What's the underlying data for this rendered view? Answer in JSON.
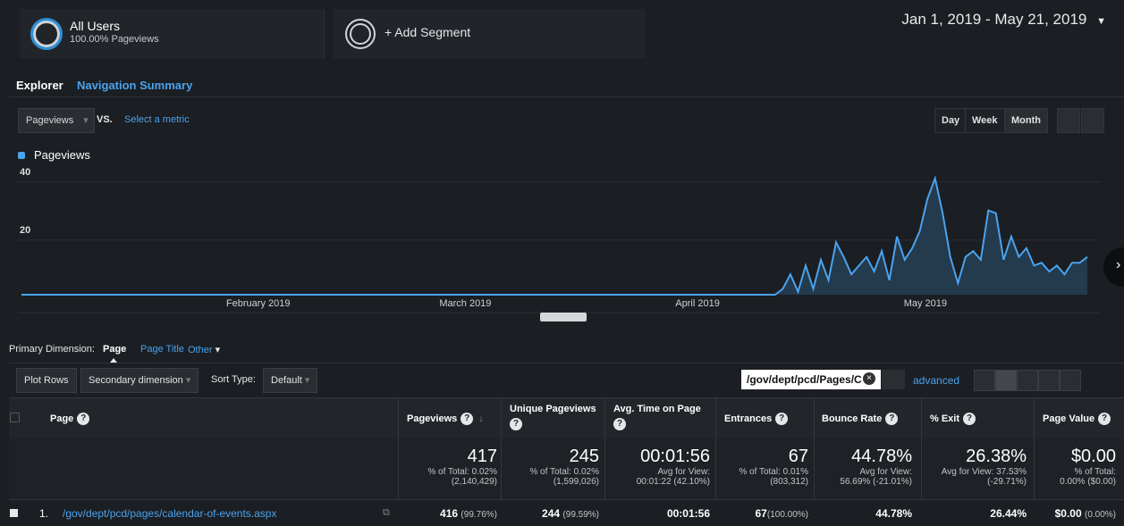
{
  "segments": {
    "all_users": {
      "title": "All Users",
      "sub": "100.00% Pageviews"
    },
    "add_segment": "+ Add Segment",
    "date_range": "Jan 1, 2019 - May 21, 2019"
  },
  "tabs": {
    "explorer": "Explorer",
    "nav_summary": "Navigation Summary"
  },
  "controls": {
    "metric": "Pageviews",
    "vs": "VS.",
    "select_metric": "Select a metric",
    "day": "Day",
    "week": "Week",
    "month": "Month"
  },
  "chart_data": {
    "type": "area",
    "series": [
      {
        "name": "Pageviews",
        "color": "#4aa3ef"
      }
    ],
    "y_ticks": [
      "40",
      "20"
    ],
    "x_ticks": [
      "February 2019",
      "March 2019",
      "April 2019",
      "May 2019"
    ],
    "ylim": [
      0,
      43
    ],
    "x_start": "2019-01-01",
    "x_end": "2019-05-21",
    "points": [
      [
        "2019-01-01",
        0
      ],
      [
        "2019-04-10",
        0
      ],
      [
        "2019-04-11",
        2
      ],
      [
        "2019-04-12",
        7
      ],
      [
        "2019-04-13",
        1
      ],
      [
        "2019-04-14",
        10
      ],
      [
        "2019-04-15",
        2
      ],
      [
        "2019-04-16",
        12
      ],
      [
        "2019-04-17",
        5
      ],
      [
        "2019-04-18",
        18
      ],
      [
        "2019-04-19",
        13
      ],
      [
        "2019-04-20",
        7
      ],
      [
        "2019-04-21",
        10
      ],
      [
        "2019-04-22",
        13
      ],
      [
        "2019-04-23",
        8
      ],
      [
        "2019-04-24",
        15
      ],
      [
        "2019-04-25",
        5
      ],
      [
        "2019-04-26",
        20
      ],
      [
        "2019-04-27",
        12
      ],
      [
        "2019-04-28",
        16
      ],
      [
        "2019-04-29",
        22
      ],
      [
        "2019-04-30",
        33
      ],
      [
        "2019-05-01",
        40
      ],
      [
        "2019-05-02",
        28
      ],
      [
        "2019-05-03",
        13
      ],
      [
        "2019-05-04",
        4
      ],
      [
        "2019-05-05",
        13
      ],
      [
        "2019-05-06",
        15
      ],
      [
        "2019-05-07",
        12
      ],
      [
        "2019-05-08",
        29
      ],
      [
        "2019-05-09",
        28
      ],
      [
        "2019-05-10",
        12
      ],
      [
        "2019-05-11",
        20
      ],
      [
        "2019-05-12",
        13
      ],
      [
        "2019-05-13",
        16
      ],
      [
        "2019-05-14",
        10
      ],
      [
        "2019-05-15",
        11
      ],
      [
        "2019-05-16",
        8
      ],
      [
        "2019-05-17",
        10
      ],
      [
        "2019-05-18",
        7
      ],
      [
        "2019-05-19",
        11
      ],
      [
        "2019-05-20",
        11
      ],
      [
        "2019-05-21",
        13
      ]
    ]
  },
  "primary_dim": {
    "label": "Primary Dimension:",
    "page": "Page",
    "page_title": "Page Title",
    "other": "Other"
  },
  "toolbar": {
    "plot_rows": "Plot Rows",
    "secondary": "Secondary dimension",
    "sort_type": "Sort Type:",
    "default": "Default",
    "filter_value": "/gov/dept/pcd/Pages/C",
    "advanced": "advanced"
  },
  "table": {
    "headers": {
      "page": "Page",
      "pageviews": "Pageviews",
      "unique": "Unique Pageviews",
      "avg_time": "Avg. Time on Page",
      "entrances": "Entrances",
      "bounce": "Bounce Rate",
      "exit": "% Exit",
      "value": "Page Value"
    },
    "totals": {
      "pageviews": {
        "val": "417",
        "l1": "% of Total: 0.02%",
        "l2": "(2,140,429)"
      },
      "unique": {
        "val": "245",
        "l1": "% of Total: 0.02%",
        "l2": "(1,599,026)"
      },
      "avg_time": {
        "val": "00:01:56",
        "l1": "Avg for View:",
        "l2": "00:01:22 (42.10%)"
      },
      "entrances": {
        "val": "67",
        "l1": "% of Total: 0.01%",
        "l2": "(803,312)"
      },
      "bounce": {
        "val": "44.78%",
        "l1": "Avg for View:",
        "l2": "56.69% (-21.01%)"
      },
      "exit": {
        "val": "26.38%",
        "l1": "Avg for View: 37.53%",
        "l2": "(-29.71%)"
      },
      "value": {
        "val": "$0.00",
        "l1": "% of Total:",
        "l2": "0.00% ($0.00)"
      }
    },
    "rows": [
      {
        "index": "1.",
        "page": "/gov/dept/pcd/pages/calendar-of-events.aspx",
        "pageviews": "416",
        "pageviews_pct": "(99.76%)",
        "unique": "244",
        "unique_pct": "(99.59%)",
        "avg_time": "00:01:56",
        "entrances": "67",
        "entrances_pct": "(100.00%)",
        "bounce": "44.78%",
        "exit": "26.44%",
        "value": "$0.00",
        "value_pct": "(0.00%)"
      }
    ]
  }
}
